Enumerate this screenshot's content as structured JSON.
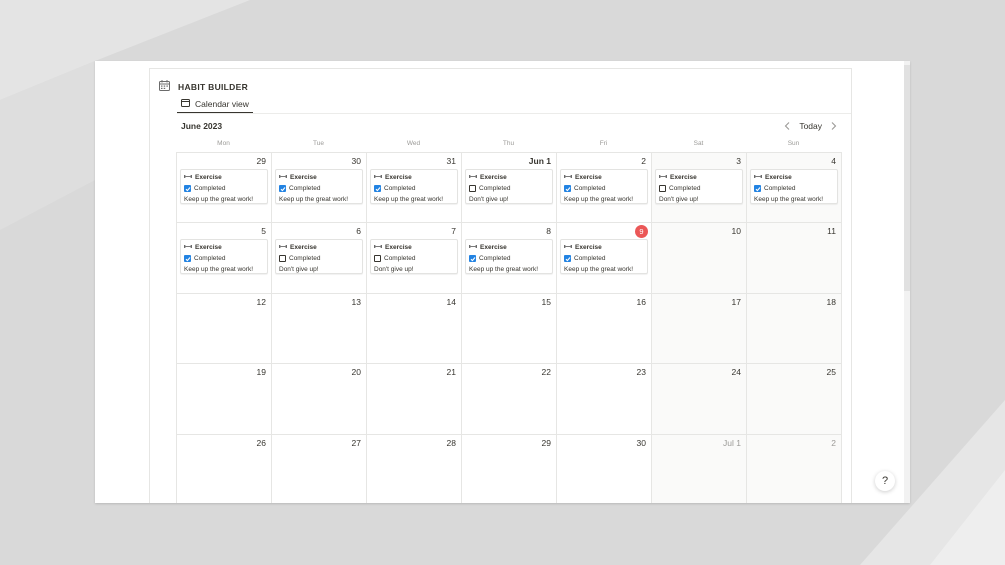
{
  "database": {
    "title": "HABIT BUILDER",
    "icon": "calendar-icon"
  },
  "view_tab": {
    "label": "Calendar view",
    "icon": "calendar-view-icon"
  },
  "calendar": {
    "month_label": "June 2023",
    "today_label": "Today",
    "weekdays": [
      "Mon",
      "Tue",
      "Wed",
      "Thu",
      "Fri",
      "Sat",
      "Sun"
    ],
    "weeks": [
      [
        {
          "date": "29",
          "entry": {
            "title": "Exercise",
            "checkbox_label": "Completed",
            "checked": true,
            "note": "Keep up the great work!"
          }
        },
        {
          "date": "30",
          "entry": {
            "title": "Exercise",
            "checkbox_label": "Completed",
            "checked": true,
            "note": "Keep up the great work!"
          }
        },
        {
          "date": "31",
          "entry": {
            "title": "Exercise",
            "checkbox_label": "Completed",
            "checked": true,
            "note": "Keep up the great work!"
          }
        },
        {
          "date": "Jun 1",
          "bold": true,
          "entry": {
            "title": "Exercise",
            "checkbox_label": "Completed",
            "checked": false,
            "note": "Don't give up!"
          }
        },
        {
          "date": "2",
          "entry": {
            "title": "Exercise",
            "checkbox_label": "Completed",
            "checked": true,
            "note": "Keep up the great work!"
          }
        },
        {
          "date": "3",
          "weekend": true,
          "entry": {
            "title": "Exercise",
            "checkbox_label": "Completed",
            "checked": false,
            "note": "Don't give up!"
          }
        },
        {
          "date": "4",
          "weekend": true,
          "entry": {
            "title": "Exercise",
            "checkbox_label": "Completed",
            "checked": true,
            "note": "Keep up the great work!"
          }
        }
      ],
      [
        {
          "date": "5",
          "entry": {
            "title": "Exercise",
            "checkbox_label": "Completed",
            "checked": true,
            "note": "Keep up the great work!"
          }
        },
        {
          "date": "6",
          "entry": {
            "title": "Exercise",
            "checkbox_label": "Completed",
            "checked": false,
            "note": "Don't give up!"
          }
        },
        {
          "date": "7",
          "entry": {
            "title": "Exercise",
            "checkbox_label": "Completed",
            "checked": false,
            "note": "Don't give up!"
          }
        },
        {
          "date": "8",
          "entry": {
            "title": "Exercise",
            "checkbox_label": "Completed",
            "checked": true,
            "note": "Keep up the great work!"
          }
        },
        {
          "date": "9",
          "today": true,
          "entry": {
            "title": "Exercise",
            "checkbox_label": "Completed",
            "checked": true,
            "note": "Keep up the great work!"
          }
        },
        {
          "date": "10",
          "weekend": true
        },
        {
          "date": "11",
          "weekend": true
        }
      ],
      [
        {
          "date": "12"
        },
        {
          "date": "13"
        },
        {
          "date": "14"
        },
        {
          "date": "15"
        },
        {
          "date": "16"
        },
        {
          "date": "17",
          "weekend": true
        },
        {
          "date": "18",
          "weekend": true
        }
      ],
      [
        {
          "date": "19"
        },
        {
          "date": "20"
        },
        {
          "date": "21"
        },
        {
          "date": "22"
        },
        {
          "date": "23"
        },
        {
          "date": "24",
          "weekend": true
        },
        {
          "date": "25",
          "weekend": true
        }
      ],
      [
        {
          "date": "26"
        },
        {
          "date": "27"
        },
        {
          "date": "28"
        },
        {
          "date": "29"
        },
        {
          "date": "30"
        },
        {
          "date": "Jul 1",
          "weekend": true,
          "muted": true
        },
        {
          "date": "2",
          "weekend": true,
          "muted": true
        }
      ]
    ]
  },
  "help_button": {
    "label": "?"
  },
  "colors": {
    "accent": "#2383e2",
    "today": "#eb5757",
    "text": "#37352f",
    "muted": "#9b9a97"
  }
}
